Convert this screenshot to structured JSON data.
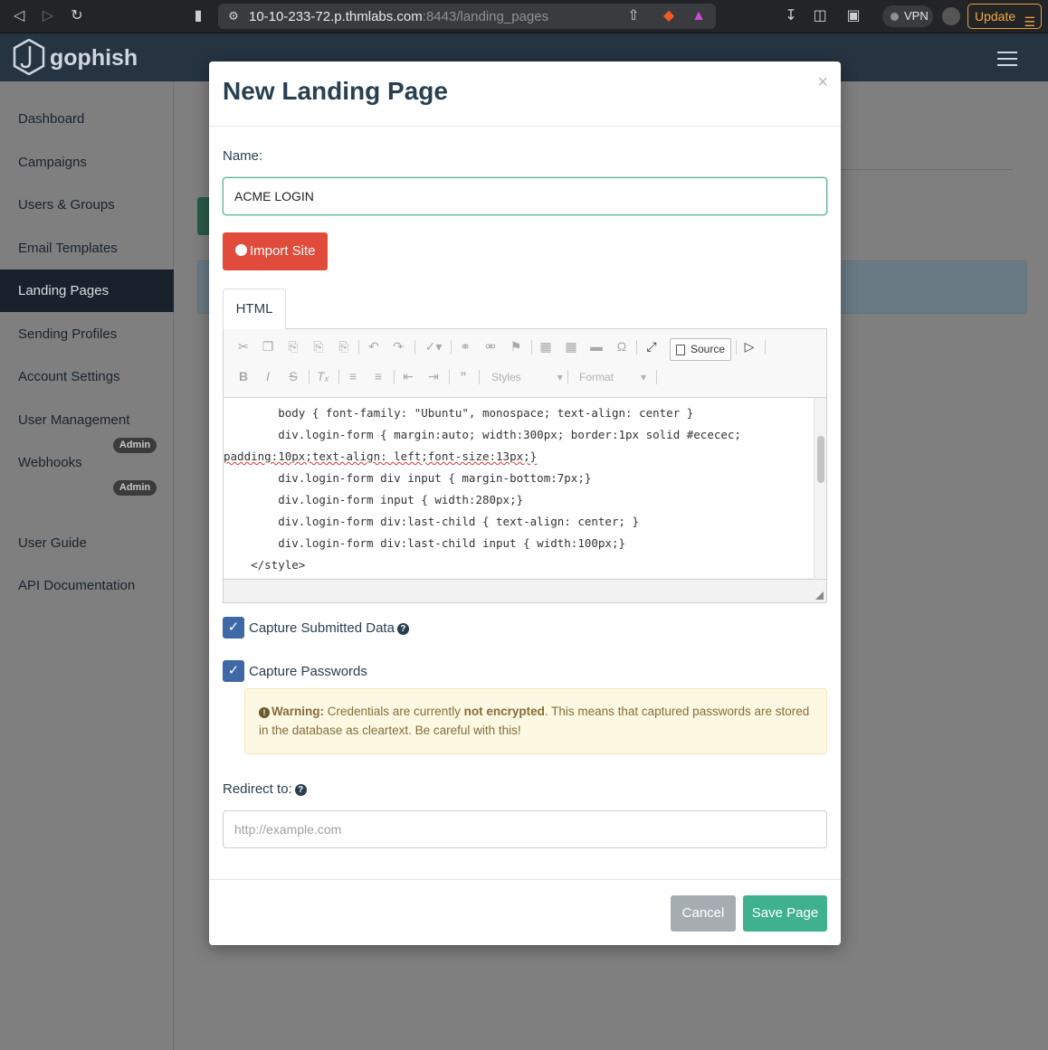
{
  "browser": {
    "url_host": "10-10-233-72.p.thmlabs.com",
    "url_rest": ":8443/landing_pages",
    "vpn_label": "VPN",
    "update_label": "Update"
  },
  "app": {
    "logo_text": "gophish"
  },
  "sidebar": {
    "items": [
      {
        "label": "Dashboard"
      },
      {
        "label": "Campaigns"
      },
      {
        "label": "Users & Groups"
      },
      {
        "label": "Email Templates"
      },
      {
        "label": "Landing Pages"
      },
      {
        "label": "Sending Profiles"
      },
      {
        "label": "Account Settings"
      },
      {
        "label": "User Management"
      },
      {
        "label": "Webhooks"
      },
      {
        "label": "User Guide"
      },
      {
        "label": "API Documentation"
      }
    ],
    "admin_badge": "Admin",
    "active_item": "Landing Pages"
  },
  "modal": {
    "title": "New Landing Page",
    "close": "×",
    "name_label": "Name:",
    "name_value": "ACME LOGIN",
    "import_label": "Import Site",
    "tab_label": "HTML",
    "source_label": "Source",
    "styles_label": "Styles",
    "format_label": "Format",
    "code_lines": [
      "        body { font-family: \"Ubuntu\", monospace; text-align: center }",
      "        div.login-form { margin:auto; width:300px; border:1px solid #ececec;",
      "padding:10px;text-align: left;font-size:13px;}",
      "        div.login-form div input { margin-bottom:7px;}",
      "        div.login-form input { width:280px;}",
      "        div.login-form div:last-child { text-align: center; }",
      "        div.login-form div:last-child input { width:100px;}",
      "    </style>"
    ],
    "capture_data_label": "Capture Submitted Data",
    "capture_passwords_label": "Capture Passwords",
    "warning_strong": "Warning:",
    "warning_text_1": " Credentials are currently ",
    "warning_emph": "not encrypted",
    "warning_text_2": ". This means that captured passwords are stored in the database as cleartext. Be careful with this!",
    "redirect_label": "Redirect to:",
    "redirect_placeholder": "http://example.com",
    "cancel_label": "Cancel",
    "save_label": "Save Page"
  },
  "colors": {
    "navbar": "#263341",
    "import_button": "#e14b3b",
    "save_button": "#3fb18f",
    "checkbox": "#3f69a6",
    "warning_bg": "#fcf8e2"
  }
}
